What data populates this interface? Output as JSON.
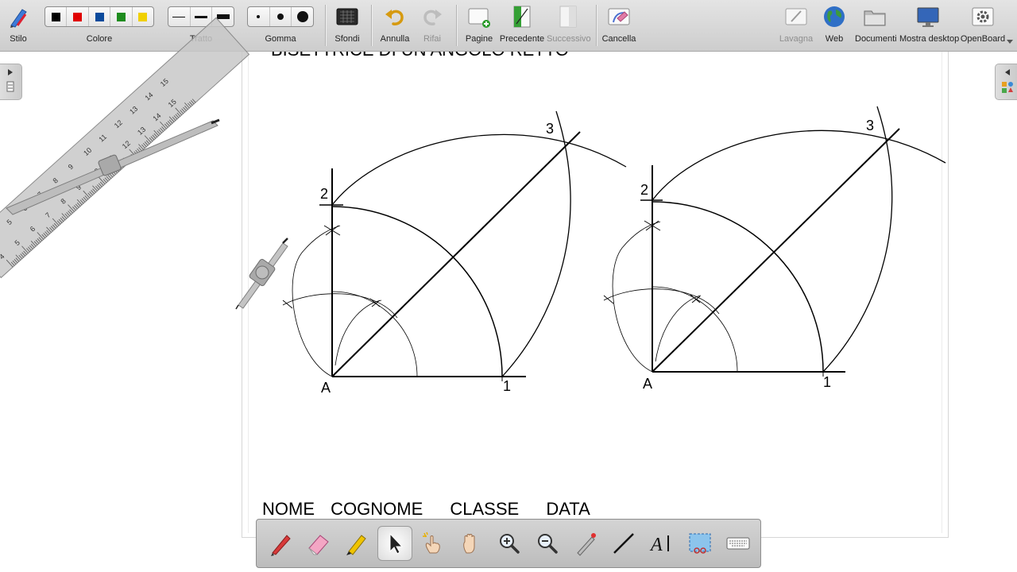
{
  "toolbar": {
    "stilo": "Stilo",
    "colore": "Colore",
    "colors": [
      "#000000",
      "#e00000",
      "#0a4a9c",
      "#1e8c1e",
      "#f0d000"
    ],
    "tratto": "Tratto",
    "gomma": "Gomma",
    "sfondi": "Sfondi",
    "annulla": "Annulla",
    "rifai": "Rifai",
    "pagine": "Pagine",
    "precedente": "Precedente",
    "successivo": "Successivo",
    "cancella": "Cancella",
    "lavagna": "Lavagna",
    "web": "Web",
    "documenti": "Documenti",
    "mostra_desktop": "Mostra desktop",
    "openboard": "OpenBoard"
  },
  "page": {
    "title_partial": "BISETTRICE DI UN ANGOLO RETTO",
    "figure_labels": {
      "vertex": "A",
      "point1": "1",
      "point2": "2",
      "point3": "3"
    },
    "footer_fields": [
      "NOME",
      "COGNOME",
      "CLASSE",
      "DATA"
    ]
  },
  "ruler_numbers": [
    "4",
    "5",
    "6",
    "7",
    "8",
    "9",
    "10",
    "11",
    "12",
    "13",
    "14",
    "15"
  ],
  "stylus_tools": [
    "pen-icon",
    "eraser-icon",
    "marker-icon",
    "pointer-icon",
    "laser-icon",
    "hand-icon",
    "zoom-in-icon",
    "zoom-out-icon",
    "laser-pointer-icon",
    "line-icon",
    "text-icon",
    "capture-icon",
    "keyboard-icon"
  ]
}
